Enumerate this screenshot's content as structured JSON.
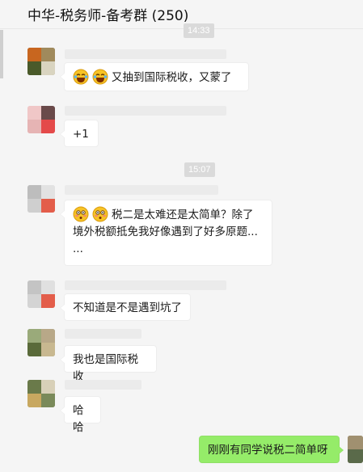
{
  "header": {
    "title": "中华-税务师-备考群 (250)"
  },
  "timestamps": {
    "t1": "14:33",
    "t2": "15:07"
  },
  "messages": [
    {
      "emoji": [
        "laughing-crying-icon",
        "laughing-crying-icon"
      ],
      "text": "又抽到国际税收，又蒙了"
    },
    {
      "text": "+1"
    },
    {
      "emoji": [
        "flushed-face-icon",
        "flushed-face-icon"
      ],
      "text_line1": "税二是太难还是太简单？除了",
      "text_line2": "境外税额抵免我好像遇到了好多原题...",
      "text_line3": "..."
    },
    {
      "text": "不知道是不是遇到坑了"
    },
    {
      "text": "我也是国际税收"
    },
    {
      "text": "哈哈"
    },
    {
      "text": "刚刚有同学说税二简单呀",
      "mine": true
    }
  ],
  "colors": {
    "my_bubble": "#95ec69",
    "background": "#f5f5f5",
    "timestamp_bg": "#dadada"
  }
}
